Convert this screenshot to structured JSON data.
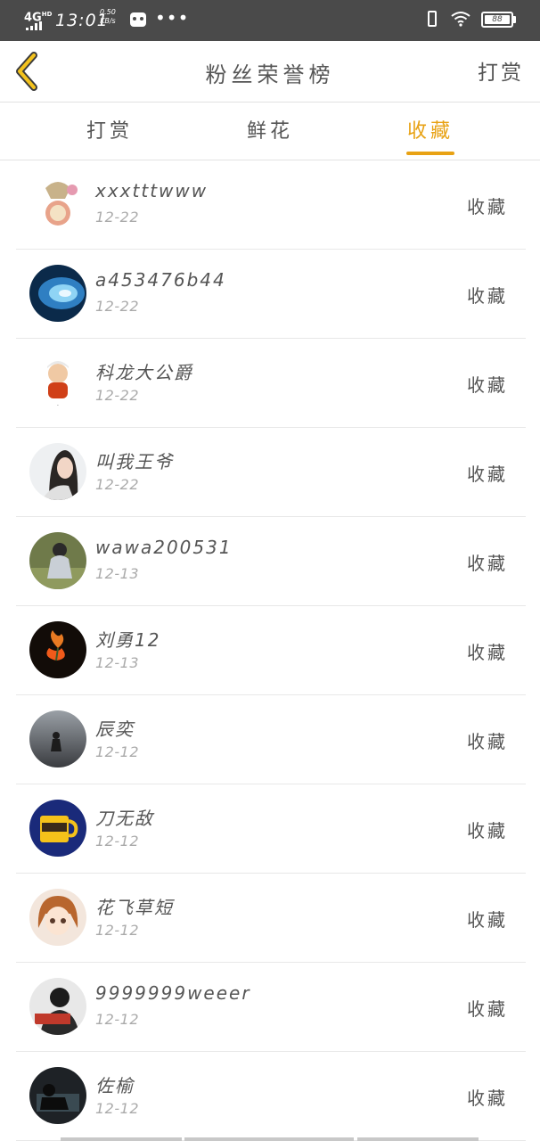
{
  "status_bar": {
    "network": "4G",
    "network_sup": "HD",
    "time": "13:01",
    "speed_value": "0.50",
    "speed_unit": "KB/s",
    "more": "•••",
    "battery": "88"
  },
  "header": {
    "title": "粉丝荣誉榜",
    "action_label": "打赏",
    "back_icon": "chevron-left-icon",
    "accent_color": "#e8a214"
  },
  "tabs": [
    {
      "label": "打赏",
      "active": false
    },
    {
      "label": "鲜花",
      "active": false
    },
    {
      "label": "收藏",
      "active": true
    }
  ],
  "fans": [
    {
      "name": "xxxtttwww",
      "date": "12-22",
      "action": "收藏"
    },
    {
      "name": "a453476b44",
      "date": "12-22",
      "action": "收藏"
    },
    {
      "name": "科龙大公爵",
      "date": "12-22",
      "action": "收藏"
    },
    {
      "name": "叫我王爷",
      "date": "12-22",
      "action": "收藏"
    },
    {
      "name": "wawa200531",
      "date": "12-13",
      "action": "收藏"
    },
    {
      "name": "刘勇12",
      "date": "12-13",
      "action": "收藏"
    },
    {
      "name": "辰奕",
      "date": "12-12",
      "action": "收藏"
    },
    {
      "name": "刀无敌",
      "date": "12-12",
      "action": "收藏"
    },
    {
      "name": "花飞草短",
      "date": "12-12",
      "action": "收藏"
    },
    {
      "name": "9999999weeer",
      "date": "12-12",
      "action": "收藏"
    },
    {
      "name": "佐榆",
      "date": "12-12",
      "action": "收藏"
    }
  ]
}
